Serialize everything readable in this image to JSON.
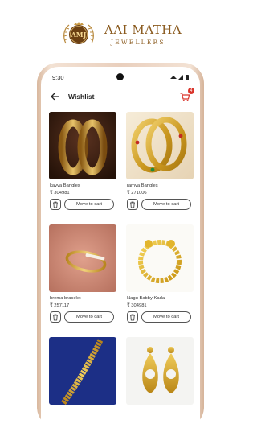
{
  "brand": {
    "logo_text": "AMJ",
    "name": "AAI MATHA",
    "subtitle": "JEWELLERS"
  },
  "status_bar": {
    "time": "9:30"
  },
  "app_bar": {
    "title": "Wishlist",
    "cart_badge_count": "4"
  },
  "colors": {
    "brand_gold": "#8a5a1e",
    "badge_red": "#d9342b"
  },
  "wishlist": [
    {
      "name": "kavya Bangles",
      "price": "₹ 304981",
      "move_label": "Move to cart"
    },
    {
      "name": "ramya Bangles",
      "price": "₹ 271006",
      "move_label": "Move to cart"
    },
    {
      "name": "brema bracelet",
      "price": "₹ 257117",
      "move_label": "Move to cart"
    },
    {
      "name": "Nagu Babby Kada",
      "price": "₹ 304981",
      "move_label": "Move to cart"
    },
    {
      "name": "",
      "price": "",
      "move_label": ""
    },
    {
      "name": "",
      "price": "",
      "move_label": ""
    }
  ]
}
